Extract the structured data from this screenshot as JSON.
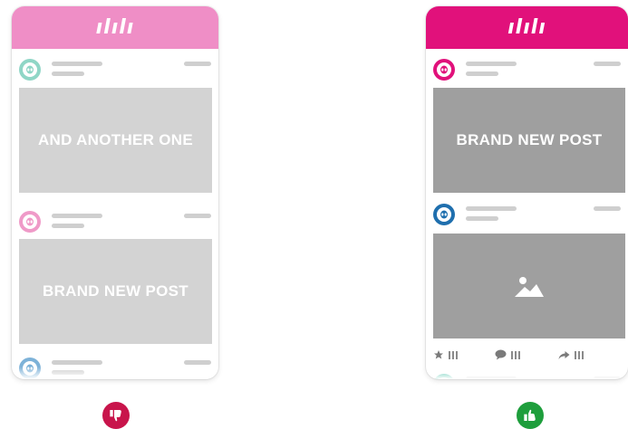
{
  "colors": {
    "left_bar": "#ef8ec6",
    "right_bar": "#e1117b",
    "left_avatar_1": "#8fd6c6",
    "left_avatar_2": "#ef9ac8",
    "left_avatar_3": "#7db2d8",
    "right_avatar_1": "#e1117b",
    "right_avatar_2": "#1f6fae",
    "right_avatar_3": "#42bfa6",
    "thumbs_down_bg": "#c8144b",
    "thumbs_up_bg": "#1e9e3c"
  },
  "left_phone": {
    "logo": "ılılı",
    "posts": [
      {
        "image_text": "AND ANOTHER ONE"
      },
      {
        "image_text": "BRAND NEW POST"
      }
    ]
  },
  "right_phone": {
    "logo": "ılılı",
    "posts": [
      {
        "image_text": "BRAND NEW POST"
      },
      {
        "image_icon": "image-icon"
      }
    ],
    "actions": [
      {
        "icon": "star-icon"
      },
      {
        "icon": "comment-icon"
      },
      {
        "icon": "share-icon"
      }
    ]
  },
  "badges": {
    "left": "thumbs-down-icon",
    "right": "thumbs-up-icon"
  }
}
